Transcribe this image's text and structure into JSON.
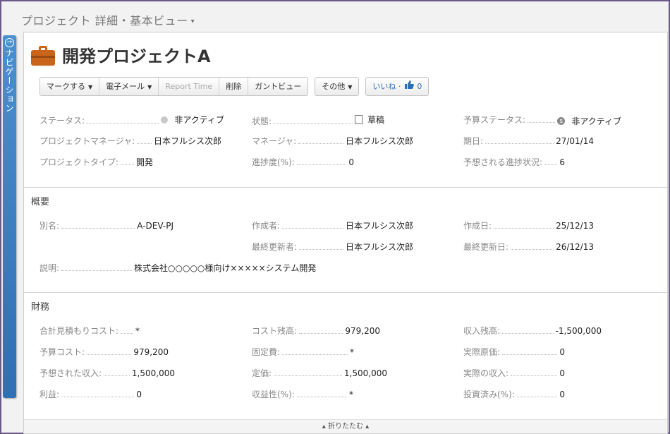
{
  "breadcrumb": {
    "text": "プロジェクト 詳細・基本ビュー",
    "caret": "▾"
  },
  "navtab": {
    "label": "ナビゲーション",
    "icon": "→"
  },
  "project": {
    "title": "開発プロジェクトA",
    "icon": "briefcase-icon"
  },
  "toolbar": {
    "mark": "マークする",
    "email": "電子メール",
    "report_time": "Report Time",
    "delete": "削除",
    "gantt": "ガントビュー",
    "other": "その他",
    "like": "いいね",
    "like_sep": "·",
    "like_count": "0"
  },
  "overview": {
    "row1": {
      "status_label": "ステータス:",
      "status_value": "非アクティブ",
      "state_label": "状態:",
      "state_value": "草稿",
      "budget_status_label": "予算ステータス:",
      "budget_status_value": "非アクティブ"
    },
    "row2": {
      "pm_label": "プロジェクトマネージャ:",
      "pm_value": "日本フルシス次郎",
      "manager_label": "マネージャ:",
      "manager_value": "日本フルシス次郎",
      "date_label": "期日:",
      "date_value": "27/01/14"
    },
    "row3": {
      "type_label": "プロジェクトタイプ:",
      "type_value": "開発",
      "progress_label": "進捗度(%):",
      "progress_value": "0",
      "expected_label": "予想される進捗状況:",
      "expected_value": "6"
    }
  },
  "summary": {
    "title": "概要",
    "alias_label": "別名:",
    "alias_value": "A-DEV-PJ",
    "creator_label": "作成者:",
    "creator_value": "日本フルシス次郎",
    "created_label": "作成日:",
    "created_value": "25/12/13",
    "updater_label": "最終更新者:",
    "updater_value": "日本フルシス次郎",
    "updated_label": "最終更新日:",
    "updated_value": "26/12/13",
    "desc_label": "説明:",
    "desc_value": "株式会社○○○○○様向け×××××システム開発"
  },
  "finance": {
    "title": "財務",
    "total_est_label": "合計見積もりコスト:",
    "total_est_value": "*",
    "cost_balance_label": "コスト残高:",
    "cost_balance_value": "979,200",
    "revenue_balance_label": "収入残高:",
    "revenue_balance_value": "-1,500,000",
    "budget_cost_label": "予算コスト:",
    "budget_cost_value": "979,200",
    "fixed_cost_label": "固定費:",
    "fixed_cost_value": "*",
    "actual_cost_label": "実際原価:",
    "actual_cost_value": "0",
    "expected_rev_label": "予想された収入:",
    "expected_rev_value": "1,500,000",
    "list_price_label": "定価:",
    "list_price_value": "1,500,000",
    "actual_rev_label": "実際の収入:",
    "actual_rev_value": "0",
    "profit_label": "利益:",
    "profit_value": "0",
    "profitability_label": "収益性(%):",
    "profitability_value": "*",
    "invested_label": "投資済み(%):",
    "invested_value": "0"
  },
  "footer": {
    "collapse": "▴ 折りたたむ ▴"
  }
}
